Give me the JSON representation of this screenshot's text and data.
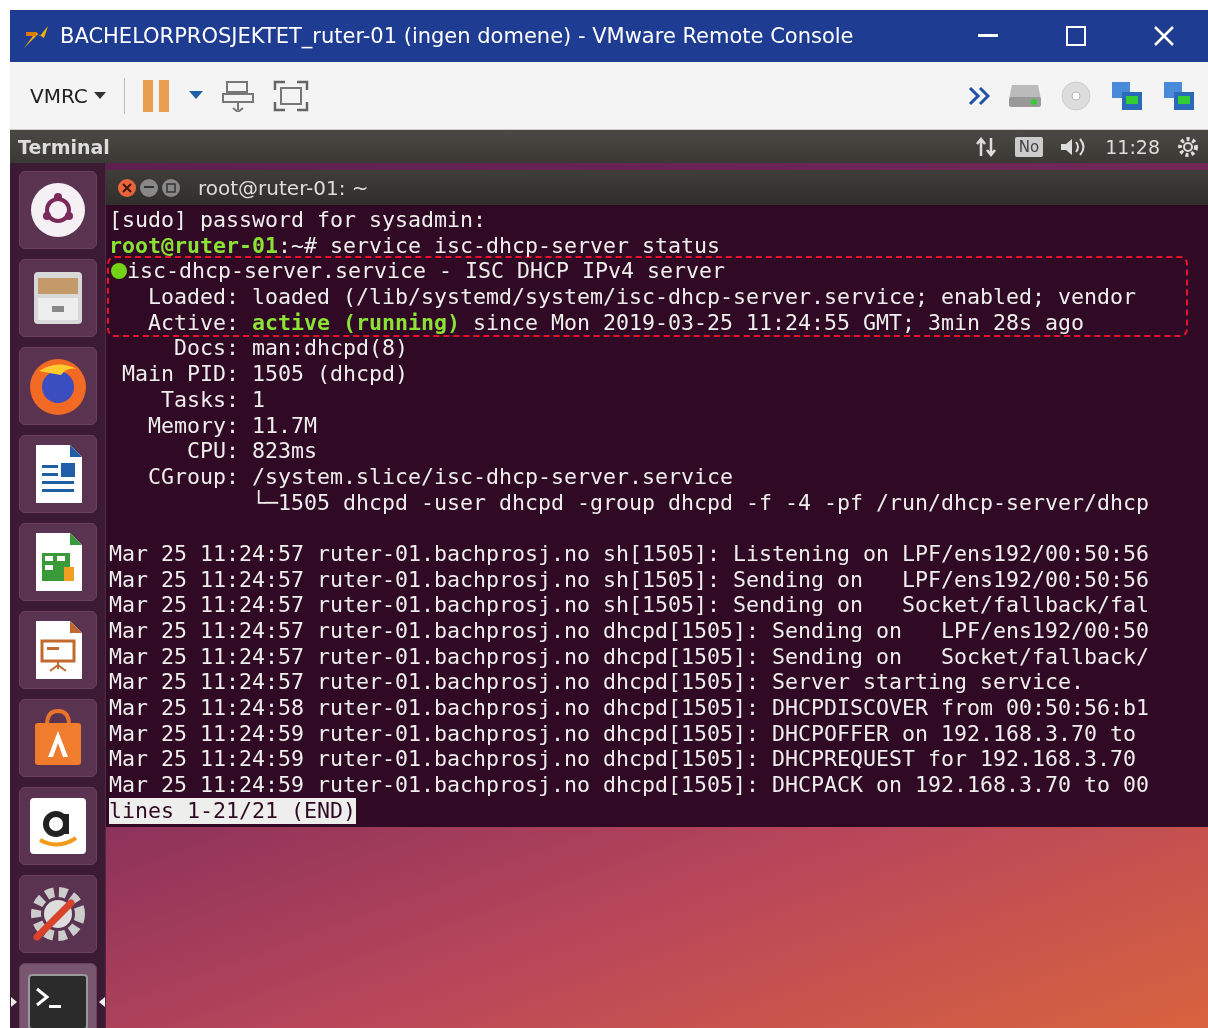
{
  "window": {
    "title": "BACHELORPROSJEKTET_ruter-01 (ingen domene) - VMware Remote Console"
  },
  "toolbar": {
    "menu_label": "VMRC",
    "paused": true
  },
  "panel": {
    "app_name": "Terminal",
    "keyboard": "No",
    "time": "11:28"
  },
  "launcher": [
    {
      "kind": "dash",
      "active": false
    },
    {
      "kind": "files",
      "active": false
    },
    {
      "kind": "firefox",
      "active": false
    },
    {
      "kind": "writer",
      "active": false
    },
    {
      "kind": "calc",
      "active": false
    },
    {
      "kind": "impress",
      "active": false
    },
    {
      "kind": "software",
      "active": false
    },
    {
      "kind": "amazon",
      "active": false
    },
    {
      "kind": "settings",
      "active": false
    },
    {
      "kind": "terminal",
      "active": true
    }
  ],
  "terminal": {
    "title": "root@ruter-01: ~",
    "lines": [
      {
        "kind": "text",
        "highlight": false,
        "segments": [
          {
            "kind": "plain",
            "text": "[sudo] password for sysadmin:"
          }
        ]
      },
      {
        "kind": "text",
        "highlight": false,
        "segments": [
          {
            "kind": "prompt",
            "text": "root@ruter-01"
          },
          {
            "kind": "plain",
            "text": ":~# service isc-dhcp-server status"
          }
        ]
      },
      {
        "kind": "text",
        "highlight": true,
        "color": "#73d216",
        "segments": [
          {
            "kind": "plain",
            "text": "isc-dhcp-server.service - ISC DHCP IPv4 server"
          }
        ]
      },
      {
        "kind": "text",
        "highlight": true,
        "segments": [
          {
            "kind": "plain",
            "text": "   Loaded: loaded (/lib/systemd/system/isc-dhcp-server.service; enabled; vendor"
          }
        ]
      },
      {
        "kind": "text",
        "highlight": true,
        "segments": [
          {
            "kind": "plain",
            "text": "   Active: "
          },
          {
            "kind": "active",
            "text": "active (running)"
          },
          {
            "kind": "plain",
            "text": " since Mon 2019-03-25 11:24:55 GMT; 3min 28s ago"
          }
        ]
      },
      {
        "kind": "text",
        "highlight": false,
        "segments": [
          {
            "kind": "plain",
            "text": "     Docs: man:dhcpd(8)"
          }
        ]
      },
      {
        "kind": "text",
        "highlight": false,
        "segments": [
          {
            "kind": "plain",
            "text": " Main PID: 1505 (dhcpd)"
          }
        ]
      },
      {
        "kind": "text",
        "highlight": false,
        "segments": [
          {
            "kind": "plain",
            "text": "    Tasks: 1"
          }
        ]
      },
      {
        "kind": "text",
        "highlight": false,
        "segments": [
          {
            "kind": "plain",
            "text": "   Memory: 11.7M"
          }
        ]
      },
      {
        "kind": "text",
        "highlight": false,
        "segments": [
          {
            "kind": "plain",
            "text": "      CPU: 823ms"
          }
        ]
      },
      {
        "kind": "text",
        "highlight": false,
        "segments": [
          {
            "kind": "plain",
            "text": "   CGroup: /system.slice/isc-dhcp-server.service"
          }
        ]
      },
      {
        "kind": "text",
        "highlight": false,
        "segments": [
          {
            "kind": "plain",
            "text": "           └─1505 dhcpd -user dhcpd -group dhcpd -f -4 -pf /run/dhcp-server/dhcp"
          }
        ]
      },
      {
        "kind": "blank"
      },
      {
        "kind": "text",
        "highlight": false,
        "segments": [
          {
            "kind": "plain",
            "text": "Mar 25 11:24:57 ruter-01.bachprosj.no sh[1505]: Listening on LPF/ens192/00:50:56"
          }
        ]
      },
      {
        "kind": "text",
        "highlight": false,
        "segments": [
          {
            "kind": "plain",
            "text": "Mar 25 11:24:57 ruter-01.bachprosj.no sh[1505]: Sending on   LPF/ens192/00:50:56"
          }
        ]
      },
      {
        "kind": "text",
        "highlight": false,
        "segments": [
          {
            "kind": "plain",
            "text": "Mar 25 11:24:57 ruter-01.bachprosj.no sh[1505]: Sending on   Socket/fallback/fal"
          }
        ]
      },
      {
        "kind": "text",
        "highlight": false,
        "segments": [
          {
            "kind": "plain",
            "text": "Mar 25 11:24:57 ruter-01.bachprosj.no dhcpd[1505]: Sending on   LPF/ens192/00:50"
          }
        ]
      },
      {
        "kind": "text",
        "highlight": false,
        "segments": [
          {
            "kind": "plain",
            "text": "Mar 25 11:24:57 ruter-01.bachprosj.no dhcpd[1505]: Sending on   Socket/fallback/"
          }
        ]
      },
      {
        "kind": "text",
        "highlight": false,
        "segments": [
          {
            "kind": "plain",
            "text": "Mar 25 11:24:57 ruter-01.bachprosj.no dhcpd[1505]: Server starting service."
          }
        ]
      },
      {
        "kind": "text",
        "highlight": false,
        "segments": [
          {
            "kind": "plain",
            "text": "Mar 25 11:24:58 ruter-01.bachprosj.no dhcpd[1505]: DHCPDISCOVER from 00:50:56:b1"
          }
        ]
      },
      {
        "kind": "text",
        "highlight": false,
        "segments": [
          {
            "kind": "plain",
            "text": "Mar 25 11:24:59 ruter-01.bachprosj.no dhcpd[1505]: DHCPOFFER on 192.168.3.70 to"
          }
        ]
      },
      {
        "kind": "text",
        "highlight": false,
        "segments": [
          {
            "kind": "plain",
            "text": "Mar 25 11:24:59 ruter-01.bachprosj.no dhcpd[1505]: DHCPREQUEST for 192.168.3.70"
          }
        ]
      },
      {
        "kind": "text",
        "highlight": false,
        "segments": [
          {
            "kind": "plain",
            "text": "Mar 25 11:24:59 ruter-01.bachprosj.no dhcpd[1505]: DHCPACK on 192.168.3.70 to 00"
          }
        ]
      },
      {
        "kind": "pager",
        "highlight": false,
        "text": "lines 1-21/21 (END)"
      }
    ]
  }
}
